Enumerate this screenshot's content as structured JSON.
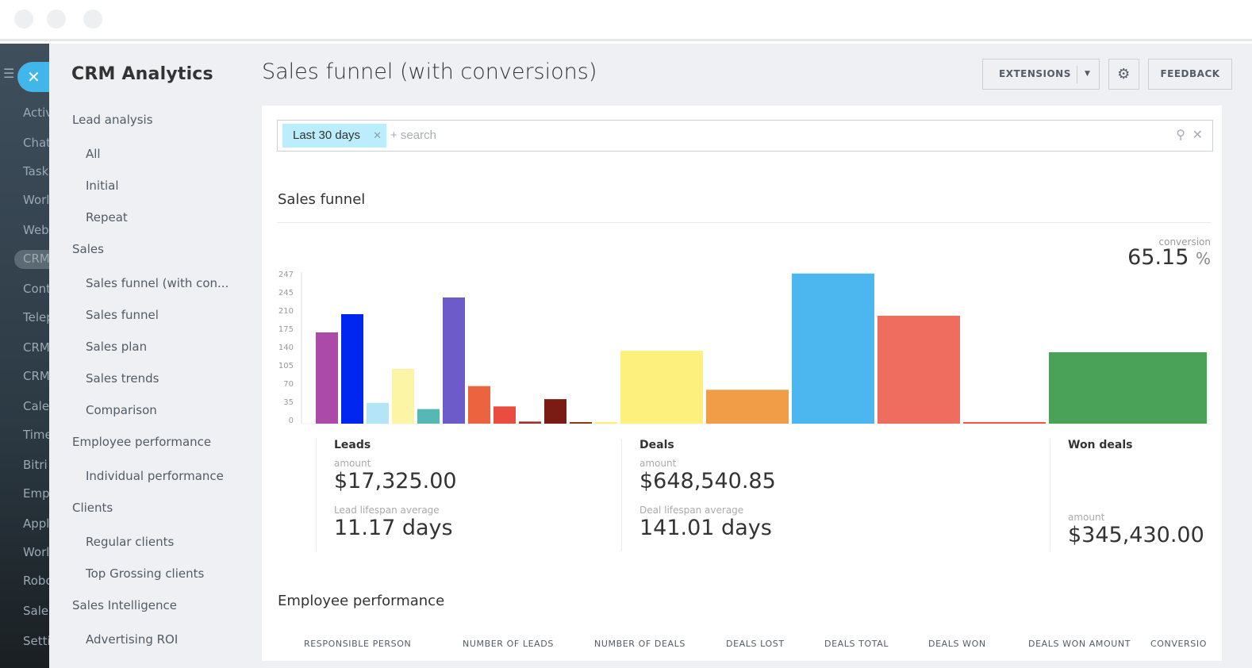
{
  "window": {
    "dots": 3
  },
  "left_bar": {
    "items": [
      "Activ",
      "Chat",
      "Task",
      "Worl",
      "Web",
      "CRM",
      "Cont",
      "Telep",
      "CRM",
      "CRM",
      "Cale",
      "Time",
      "Bitri",
      "Emp",
      "Appl",
      "Worl",
      "Robo",
      "Sales",
      "Setti"
    ]
  },
  "nav": {
    "title": "CRM Analytics",
    "items": [
      {
        "label": "Lead analysis",
        "level": 0
      },
      {
        "label": "All",
        "level": 1
      },
      {
        "label": "Initial",
        "level": 1
      },
      {
        "label": "Repeat",
        "level": 1
      },
      {
        "label": "Sales",
        "level": 0
      },
      {
        "label": "Sales funnel (with con...",
        "level": 1
      },
      {
        "label": "Sales funnel",
        "level": 1
      },
      {
        "label": "Sales plan",
        "level": 1
      },
      {
        "label": "Sales trends",
        "level": 1
      },
      {
        "label": "Comparison",
        "level": 1
      },
      {
        "label": "Employee performance",
        "level": 0
      },
      {
        "label": "Individual performance",
        "level": 1
      },
      {
        "label": "Clients",
        "level": 0
      },
      {
        "label": "Regular clients",
        "level": 1
      },
      {
        "label": "Top Grossing clients",
        "level": 1
      },
      {
        "label": "Sales Intelligence",
        "level": 0
      },
      {
        "label": "Advertising ROI",
        "level": 1
      }
    ]
  },
  "header": {
    "title": "Sales funnel (with conversions)",
    "extensions": "EXTENSIONS",
    "feedback": "FEEDBACK"
  },
  "filter": {
    "tag": "Last 30 days",
    "placeholder": "+ search"
  },
  "funnel": {
    "title": "Sales funnel",
    "conversion_label": "conversion",
    "conversion_value": "65.15",
    "conversion_unit": "%"
  },
  "chart_data": {
    "type": "bar",
    "y_tick_labels": [
      "0",
      "35",
      "70",
      "105",
      "140",
      "175",
      "210",
      "245",
      "247"
    ],
    "values": [
      175,
      210,
      40,
      105,
      28,
      242,
      72,
      33,
      4,
      47,
      1,
      1,
      140,
      65,
      288,
      207,
      3,
      137
    ],
    "colors": [
      "#ac4aa9",
      "#0026ef",
      "#b3e5f7",
      "#fdf5a6",
      "#56b8b5",
      "#6c5bc9",
      "#ec6340",
      "#ea4c3f",
      "#a1312a",
      "#7b1c14",
      "#8a3c1c",
      "#fdee70",
      "#fdf07c",
      "#f19d48",
      "#4cb6ee",
      "#ee6d5e",
      "#ee5a3a",
      "#4aa158"
    ],
    "grid": false
  },
  "stats": {
    "leads": {
      "title": "Leads",
      "amount_label": "amount",
      "amount": "$17,325.00",
      "lifespan_label": "Lead lifespan average",
      "lifespan": "11.17 days"
    },
    "deals": {
      "title": "Deals",
      "amount_label": "amount",
      "amount": "$648,540.85",
      "lifespan_label": "Deal lifespan average",
      "lifespan": "141.01 days"
    },
    "won": {
      "title": "Won deals",
      "amount_label": "amount",
      "amount": "$345,430.00"
    }
  },
  "employee": {
    "title": "Employee performance",
    "columns": [
      "RESPONSIBLE PERSON",
      "NUMBER OF LEADS",
      "NUMBER OF DEALS",
      "DEALS LOST",
      "DEALS TOTAL",
      "DEALS WON",
      "DEALS WON AMOUNT",
      "CONVERSIO"
    ]
  }
}
